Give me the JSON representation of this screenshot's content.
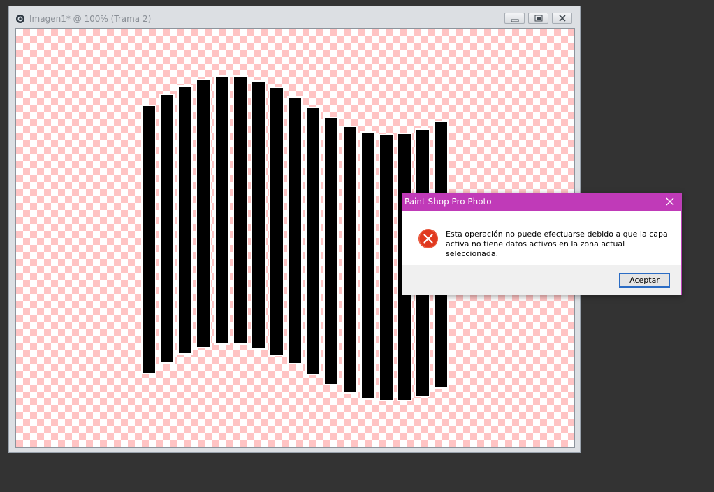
{
  "document_window": {
    "title": "Imagen1* @ 100% (Trama 2)",
    "buttons": {
      "minimize": "minimize-icon",
      "restore": "restore-icon",
      "close": "close-icon"
    },
    "canvas": {
      "checker_color": "#ffc4c4",
      "bar_color": "#000000"
    }
  },
  "dialog": {
    "title": "Paint Shop Pro Photo",
    "title_color": "#c03ab8",
    "icon": "error-icon",
    "message": "Esta operación no puede efectuarse debido a que la capa activa no tiene datos activos en la zona actual seleccionada.",
    "ok_label": "Aceptar"
  }
}
